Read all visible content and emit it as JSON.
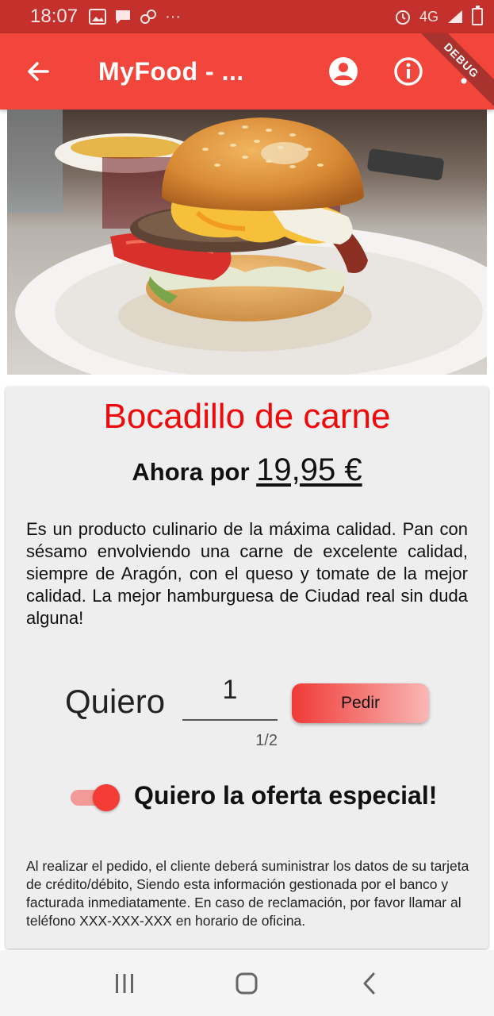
{
  "status_bar": {
    "time": "18:07",
    "ellipsis": "···",
    "network": "4G"
  },
  "app_bar": {
    "title": "MyFood - ...",
    "debug_label": "DEBUG",
    "color": "#f2463c"
  },
  "product": {
    "name": "Bocadillo de carne",
    "price_prefix": "Ahora por",
    "price": "19,95 €",
    "description": "Es un producto culinario de la máxima calidad. Pan con sésamo envolviendo una carne de excelente calidad, siempre de Aragón, con el queso y tomate de la mejor calidad. La mejor hamburguesa de Ciudad real sin duda alguna!"
  },
  "order": {
    "want_label": "Quiero",
    "quantity": "1",
    "counter": "1/2",
    "button_label": "Pedir"
  },
  "offer": {
    "label": "Quiero la oferta especial!",
    "enabled": true
  },
  "disclaimer": "Al realizar el pedido, el cliente deberá suministrar los datos de su tarjeta de crédito/débito, Siendo esta información gestionada por el banco y facturada inmediatamente. En caso de reclamación, por favor llamar al teléfono XXX-XXX-XXX en horario de oficina."
}
